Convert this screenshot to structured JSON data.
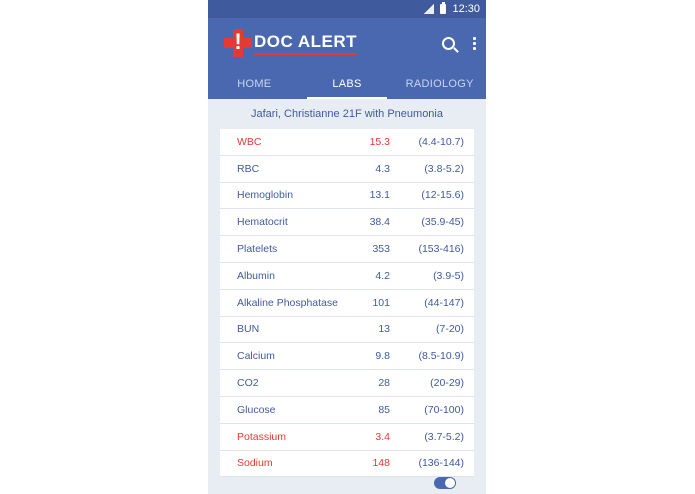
{
  "status_bar": {
    "time": "12:30"
  },
  "app_bar": {
    "logo_mark": "!",
    "logo_text": "DOC ALERT",
    "search_icon": "search-icon",
    "more_icon": "more-vert-icon"
  },
  "tabs": [
    {
      "label": "HOME",
      "active": false
    },
    {
      "label": "LABS",
      "active": true
    },
    {
      "label": "RADIOLOGY",
      "active": false
    }
  ],
  "patient": {
    "summary": "Jafari, Christianne 21F with Pneumonia"
  },
  "labs": [
    {
      "name": "WBC",
      "value": "15.3",
      "range": "(4.4-10.7)",
      "abnormal": true
    },
    {
      "name": "RBC",
      "value": "4.3",
      "range": "(3.8-5.2)",
      "abnormal": false
    },
    {
      "name": "Hemoglobin",
      "value": "13.1",
      "range": "(12-15.6)",
      "abnormal": false
    },
    {
      "name": "Hematocrit",
      "value": "38.4",
      "range": "(35.9-45)",
      "abnormal": false
    },
    {
      "name": "Platelets",
      "value": "353",
      "range": "(153-416)",
      "abnormal": false
    },
    {
      "name": "Albumin",
      "value": "4.2",
      "range": "(3.9-5)",
      "abnormal": false
    },
    {
      "name": "Alkaline Phosphatase",
      "value": "101",
      "range": "(44-147)",
      "abnormal": false
    },
    {
      "name": "BUN",
      "value": "13",
      "range": "(7-20)",
      "abnormal": false
    },
    {
      "name": "Calcium",
      "value": "9.8",
      "range": "(8.5-10.9)",
      "abnormal": false
    },
    {
      "name": "CO2",
      "value": "28",
      "range": "(20-29)",
      "abnormal": false
    },
    {
      "name": "Glucose",
      "value": "85",
      "range": "(70-100)",
      "abnormal": false
    },
    {
      "name": "Potassium",
      "value": "3.4",
      "range": "(3.7-5.2)",
      "abnormal": true
    },
    {
      "name": "Sodium",
      "value": "148",
      "range": "(136-144)",
      "abnormal": true
    }
  ],
  "toggle": {
    "on": true
  },
  "colors": {
    "primary": "#4a68b0",
    "primary_dark": "#3f5b9e",
    "alert": "#e53935",
    "background": "#e8edf4"
  }
}
